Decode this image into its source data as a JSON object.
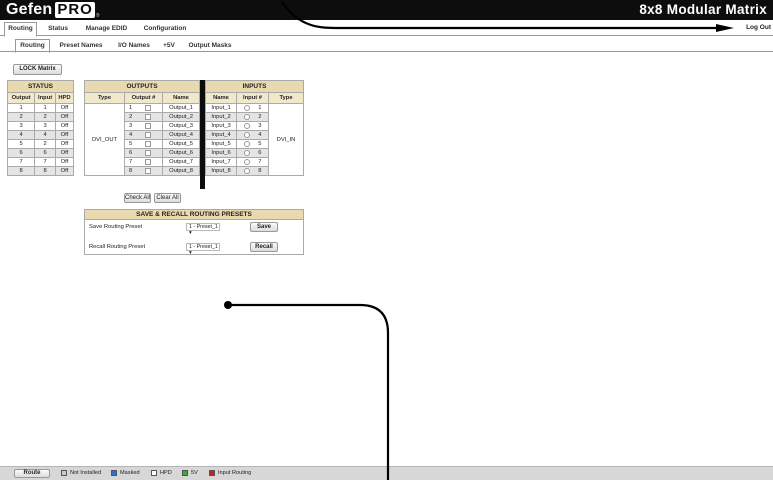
{
  "header": {
    "logo_text": "Gefen",
    "logo_badge": "PRO",
    "logo_mark": "®",
    "device_title": "8x8 Modular Matrix"
  },
  "tabs_main": [
    "Routing",
    "Status",
    "Manage EDID",
    "Configuration"
  ],
  "logout": "Log Out",
  "tabs_sub": [
    "Routing",
    "Preset Names",
    "I/O Names",
    "+5V",
    "Output Masks"
  ],
  "lock_button": "LOCK Matrix",
  "status_table": {
    "title": "STATUS",
    "columns": [
      "Output",
      "Input",
      "HPD"
    ],
    "rows": [
      [
        "1",
        "1",
        "Off"
      ],
      [
        "2",
        "2",
        "Off"
      ],
      [
        "3",
        "3",
        "Off"
      ],
      [
        "4",
        "4",
        "Off"
      ],
      [
        "5",
        "2",
        "Off"
      ],
      [
        "6",
        "6",
        "Off"
      ],
      [
        "7",
        "7",
        "Off"
      ],
      [
        "8",
        "8",
        "Off"
      ]
    ]
  },
  "outputs_table": {
    "title": "OUTPUTS",
    "columns": [
      "Type",
      "Output #",
      "Name"
    ],
    "type_value": "DVI_OUT",
    "rows": [
      {
        "num": "1",
        "name": "Output_1"
      },
      {
        "num": "2",
        "name": "Output_2"
      },
      {
        "num": "3",
        "name": "Output_3"
      },
      {
        "num": "4",
        "name": "Output_4"
      },
      {
        "num": "5",
        "name": "Output_5"
      },
      {
        "num": "6",
        "name": "Output_6"
      },
      {
        "num": "7",
        "name": "Output_7"
      },
      {
        "num": "8",
        "name": "Output_8"
      }
    ],
    "check_all": "Check All",
    "clear_all": "Clear All"
  },
  "inputs_table": {
    "title": "INPUTS",
    "columns": [
      "Name",
      "Input #",
      "Type"
    ],
    "type_value": "DVI_IN",
    "rows": [
      {
        "name": "Input_1",
        "num": "1"
      },
      {
        "name": "Input_2",
        "num": "2"
      },
      {
        "name": "Input_3",
        "num": "3"
      },
      {
        "name": "Input_4",
        "num": "4"
      },
      {
        "name": "Input_5",
        "num": "5"
      },
      {
        "name": "Input_6",
        "num": "6"
      },
      {
        "name": "Input_7",
        "num": "7"
      },
      {
        "name": "Input_8",
        "num": "8"
      }
    ]
  },
  "presets": {
    "title": "SAVE & RECALL ROUTING PRESETS",
    "save_label": "Save Routing Preset",
    "save_value": "1 - Preset_1",
    "save_button": "Save",
    "recall_label": "Recall Routing Preset",
    "recall_value": "1 - Preset_1",
    "recall_button": "Recall"
  },
  "statusbar": {
    "route_button": "Route",
    "legend": [
      {
        "label": "Not Installed",
        "color": "#c8c8c8"
      },
      {
        "label": "Masked",
        "color": "#2f6fd8"
      },
      {
        "label": "HPD",
        "color": "#ffffff"
      },
      {
        "label": "5V",
        "color": "#2fb12f"
      },
      {
        "label": "Input Routing",
        "color": "#cc1f1f"
      }
    ]
  },
  "colors": {
    "header_bg": "#0d0d0d",
    "table_head": "#e8d9ae",
    "row_alt": "#e4e4e4"
  }
}
